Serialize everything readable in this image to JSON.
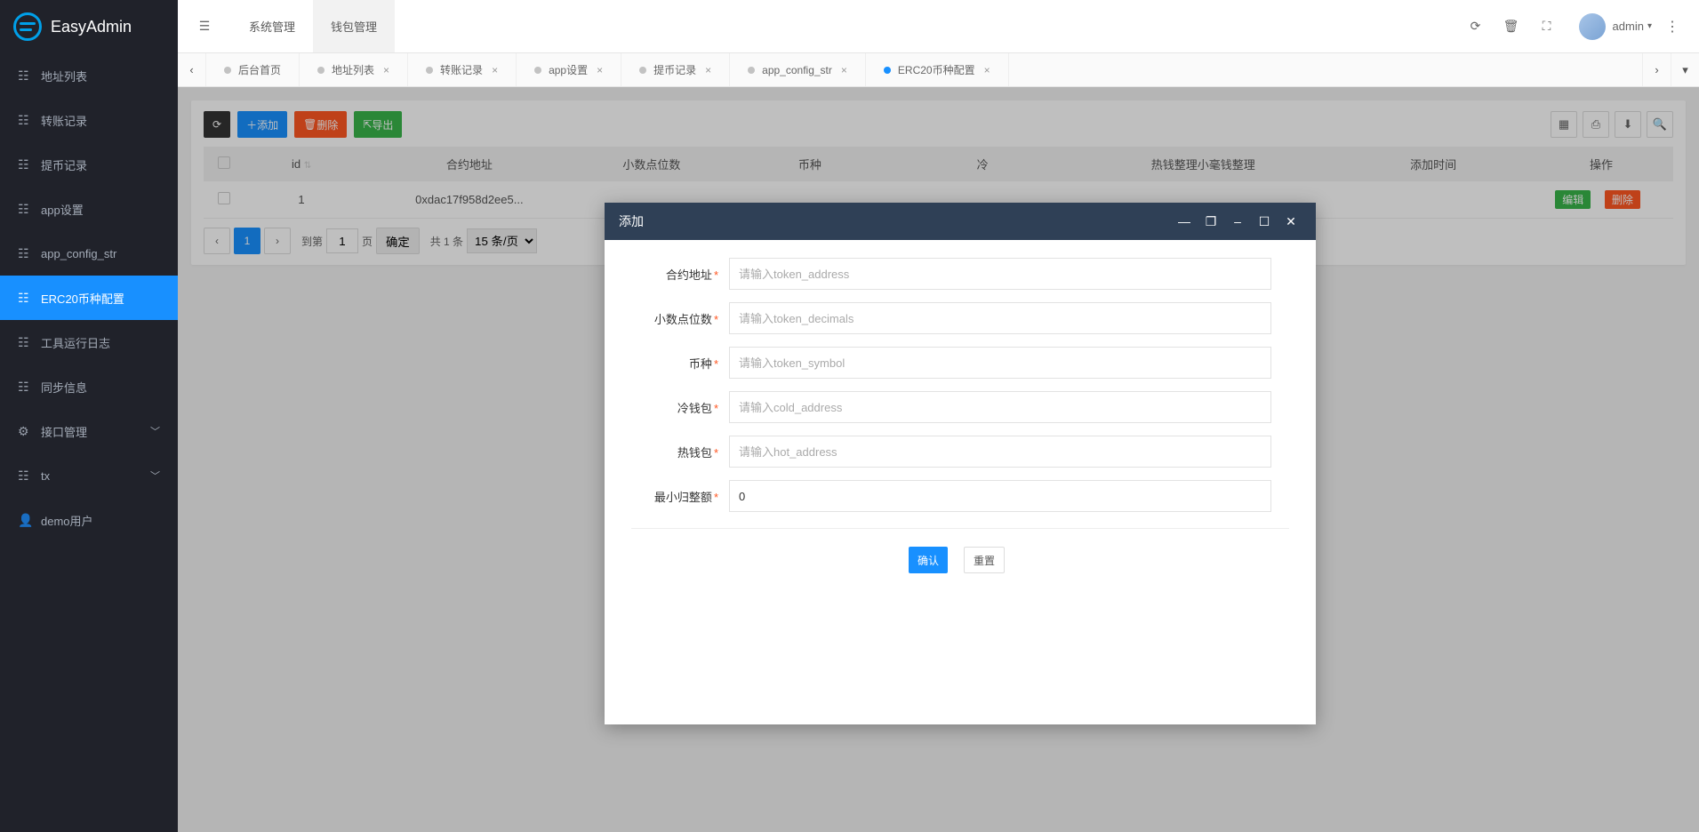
{
  "app": {
    "name": "EasyAdmin",
    "user": "admin"
  },
  "sidebar": {
    "items": [
      {
        "label": "地址列表"
      },
      {
        "label": "转账记录"
      },
      {
        "label": "提币记录"
      },
      {
        "label": "app设置"
      },
      {
        "label": "app_config_str"
      },
      {
        "label": "ERC20币种配置"
      },
      {
        "label": "工具运行日志"
      },
      {
        "label": "同步信息"
      },
      {
        "label": "接口管理",
        "arrow": true
      },
      {
        "label": "tx",
        "arrow": true
      },
      {
        "label": "demo用户"
      }
    ]
  },
  "topTabs": [
    {
      "label": "系统管理"
    },
    {
      "label": "钱包管理"
    }
  ],
  "pageTabs": [
    {
      "label": "后台首页"
    },
    {
      "label": "地址列表"
    },
    {
      "label": "转账记录"
    },
    {
      "label": "app设置"
    },
    {
      "label": "提币记录"
    },
    {
      "label": "app_config_str"
    },
    {
      "label": "ERC20币种配置"
    }
  ],
  "toolbar": {
    "add": "添加",
    "delete": "删除",
    "export": "导出"
  },
  "table": {
    "headers": [
      "id",
      "合约地址",
      "小数点位数",
      "币种",
      "冷",
      "热钱整理小毫钱整理",
      "添加时间",
      "操作"
    ],
    "rows": [
      {
        "id": "1",
        "addr": "0xdac17f958d2ee5...",
        "edit": "编辑",
        "del": "删除"
      }
    ]
  },
  "pager": {
    "current": "1",
    "jump_label": "到第",
    "page_input": "1",
    "page_label": "页",
    "confirm": "确定",
    "total": "共 1 条",
    "per_page": "15 条/页"
  },
  "modal": {
    "title": "添加",
    "fields": [
      {
        "label": "合约地址",
        "placeholder": "请输入token_address",
        "value": ""
      },
      {
        "label": "小数点位数",
        "placeholder": "请输入token_decimals",
        "value": ""
      },
      {
        "label": "币种",
        "placeholder": "请输入token_symbol",
        "value": ""
      },
      {
        "label": "冷钱包",
        "placeholder": "请输入cold_address",
        "value": ""
      },
      {
        "label": "热钱包",
        "placeholder": "请输入hot_address",
        "value": ""
      },
      {
        "label": "最小归整额",
        "placeholder": "",
        "value": "0"
      }
    ],
    "confirm": "确认",
    "reset": "重置"
  }
}
